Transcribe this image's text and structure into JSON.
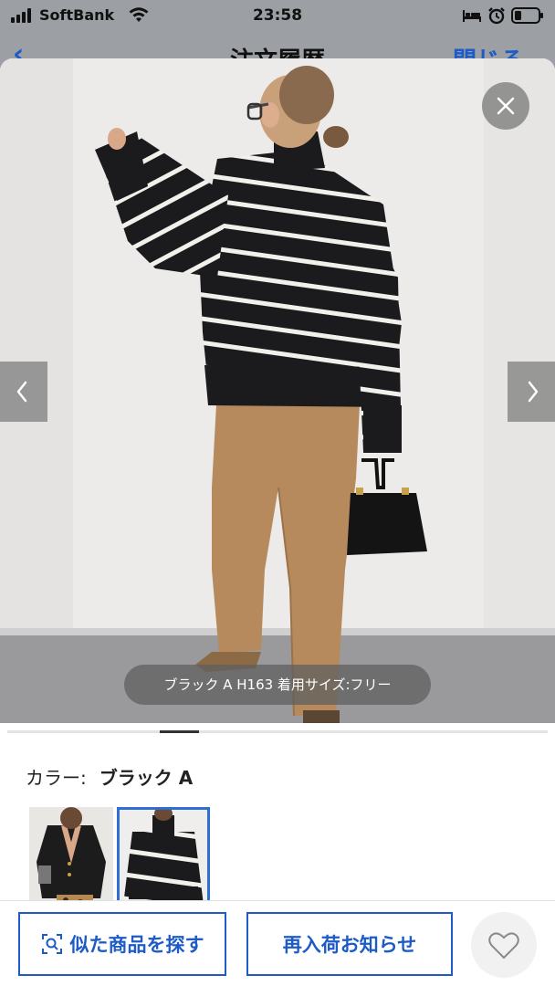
{
  "status_bar": {
    "carrier": "SoftBank",
    "time": "23:58",
    "icons": [
      "signal-icon",
      "wifi-icon",
      "bed-icon",
      "alarm-icon",
      "battery-icon"
    ]
  },
  "nav": {
    "title": "注文履歴",
    "close_label": "閉じる"
  },
  "gallery": {
    "caption": "ブラック A H163 着用サイズ:フリー",
    "total_images": 11,
    "current_index": 3
  },
  "product": {
    "color_label": "カラー:",
    "color_value": "ブラック A",
    "swatches": [
      {
        "name": "cardigan-black"
      },
      {
        "name": "sweater-black-a",
        "selected": true
      }
    ]
  },
  "actions": {
    "similar_label": "似た商品を探す",
    "restock_label": "再入荷お知らせ"
  },
  "colors": {
    "accent": "#1d5bc7",
    "selected_border": "#2e6fd1",
    "overlay": "#9c9fa3"
  }
}
